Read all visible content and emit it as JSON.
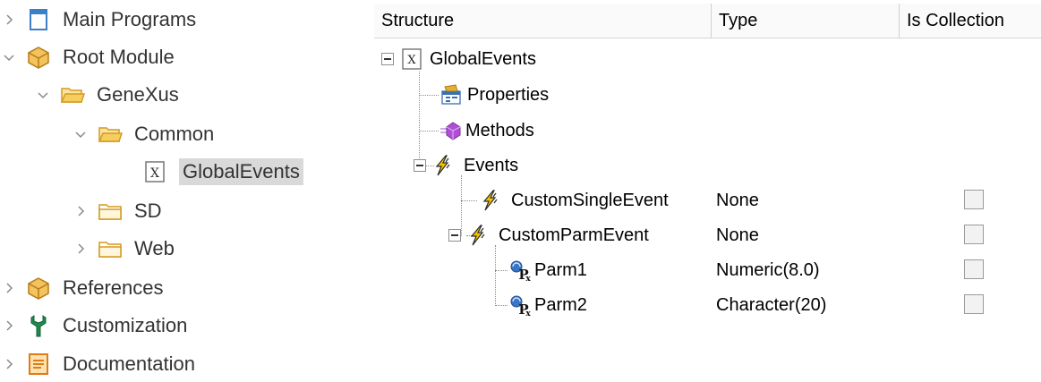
{
  "navigator": {
    "items": [
      {
        "label": "Main Programs",
        "icon": "main-programs-icon",
        "chevron": "right"
      },
      {
        "label": "Root Module",
        "icon": "module-icon",
        "chevron": "down"
      },
      {
        "label": "GeneXus",
        "icon": "folder-icon",
        "chevron": "down"
      },
      {
        "label": "Common",
        "icon": "folder-icon",
        "chevron": "down"
      },
      {
        "label": "GlobalEvents",
        "icon": "external-object-icon",
        "chevron": "",
        "selected": true
      },
      {
        "label": "SD",
        "icon": "folder-icon",
        "chevron": "right"
      },
      {
        "label": "Web",
        "icon": "folder-icon",
        "chevron": "right"
      },
      {
        "label": "References",
        "icon": "module-icon",
        "chevron": "right"
      },
      {
        "label": "Customization",
        "icon": "wrench-icon",
        "chevron": "right"
      },
      {
        "label": "Documentation",
        "icon": "documentation-icon",
        "chevron": "right"
      }
    ]
  },
  "structure": {
    "columns": [
      "Structure",
      "Type",
      "Is Collection"
    ],
    "root": {
      "label": "GlobalEvents",
      "icon": "x-object-icon"
    },
    "properties": {
      "label": "Properties",
      "icon": "properties-icon"
    },
    "methods": {
      "label": "Methods",
      "icon": "methods-icon"
    },
    "events": {
      "label": "Events",
      "icon": "lightning-icon"
    },
    "rows": [
      {
        "name": "CustomSingleEvent",
        "type": "None",
        "is_collection": false
      },
      {
        "name": "CustomParmEvent",
        "type": "None",
        "is_collection": false
      },
      {
        "name": "Parm1",
        "type": "Numeric(8.0)",
        "is_collection": false
      },
      {
        "name": "Parm2",
        "type": "Character(20)",
        "is_collection": false
      }
    ]
  },
  "colors": {
    "folder": "#f0c24a",
    "module": "#e8a33a",
    "lightning": "#f2c200",
    "selection": "#d9d9d9"
  }
}
